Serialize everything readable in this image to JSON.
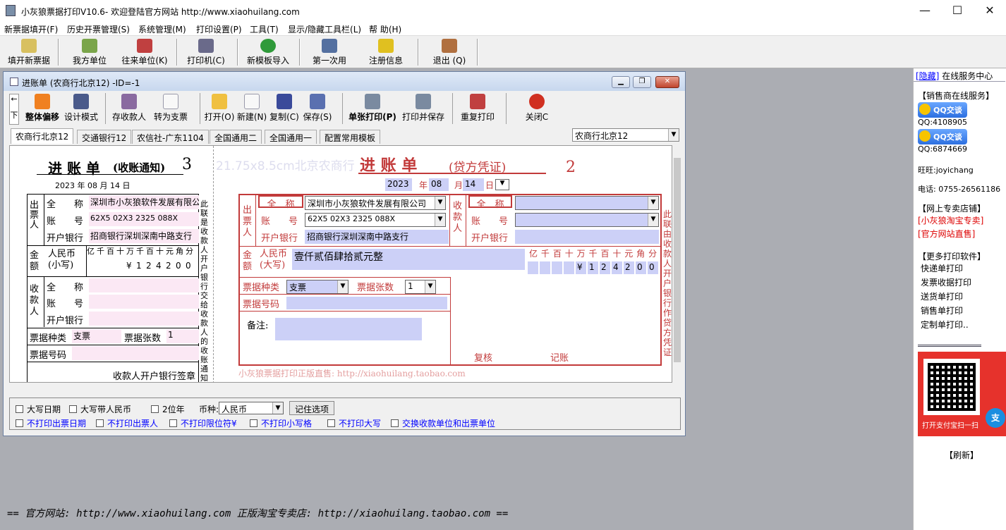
{
  "app": {
    "title": "小灰狼票据打印V10.6- 欢迎登陆官方网站 http://www.xiaohuilang.com",
    "minimize": "—",
    "maximize": "☐",
    "close": "✕"
  },
  "menu": [
    "新票据填开(F)",
    "历史开票管理(S)",
    "系统管理(M)",
    "打印设置(P)",
    "工具(T)",
    "显示/隐藏工具栏(L)",
    "帮 助(H)"
  ],
  "toolbar": [
    "填开新票据",
    "我方单位",
    "往来单位(K)",
    "打印机(C)",
    "新模板导入",
    "第一次用",
    "注册信息",
    "退出 (Q)"
  ],
  "child": {
    "title": "进账单 (农商行北京12) -ID=-1",
    "nav_up": "←",
    "nav_down": "下",
    "tools": [
      "整体偏移",
      "设计模式",
      "存收款人",
      "转为支票",
      "打开(O)",
      "新建(N)",
      "复制(C)",
      "保存(S)",
      "单张打印(P)",
      "打印并保存",
      "重复打印",
      "关闭C"
    ],
    "tabs": [
      "农商行北京12",
      "交通银行12",
      "农信社-广东1104",
      "全国通用二",
      "全国通用一",
      "配置常用模板"
    ],
    "template_select": "农商行北京12"
  },
  "left_copy": {
    "title": "进 账 单",
    "subtitle": "(收账通知)",
    "copy_no": "3",
    "date_year": "2023",
    "date_month": "08",
    "date_day": "14",
    "ymd": [
      "年",
      "月",
      "日"
    ],
    "payer_label": "出票人",
    "payee_label": "收款人",
    "amount_label": "金额",
    "rows": {
      "name": "全　　称",
      "account": "账　　号",
      "bank": "开户银行"
    },
    "payer_name": "深圳市小灰狼软件发展有限公",
    "payer_account": "62X5 02X3 2325 088X",
    "payer_bank": "招商银行深圳深南中路支行",
    "rmb_label": "人民币(小写)",
    "digits_head": [
      "亿",
      "千",
      "百",
      "十",
      "万",
      "千",
      "百",
      "十",
      "元",
      "角",
      "分"
    ],
    "digits": [
      "",
      "",
      "",
      "",
      "¥",
      "1",
      "2",
      "4",
      "2",
      "0",
      "0"
    ],
    "bill_type_label": "票据种类",
    "bill_type": "支票",
    "bill_count_label": "票据张数",
    "bill_count": "1",
    "bill_no_label": "票据号码",
    "side_note": "此联是收款人开户银行交给收款人的收账通知",
    "sign": "收款人开户银行签章"
  },
  "right_copy": {
    "watermark": "21.75x8.5cm北京农商行",
    "title": "进 账 单",
    "subtitle": "(贷方凭证)",
    "copy_no": "2",
    "date_year": "2023",
    "date_month": "08",
    "date_day": "14",
    "payer_label": "出票人",
    "payee_label": "收款人",
    "name_label": "全　称",
    "account_label": "账　　号",
    "bank_label": "开户银行",
    "payer_name": "深圳市小灰狼软件发展有限公司",
    "payer_account": "62X5 02X3 2325 088X",
    "payer_bank": "招商银行深圳深南中路支行",
    "amount_label": "金额",
    "rmb_label": "人民币(大写)",
    "amount_words": "壹仟贰佰肆拾贰元整",
    "digits_head": [
      "亿",
      "千",
      "百",
      "十",
      "万",
      "千",
      "百",
      "十",
      "元",
      "角",
      "分"
    ],
    "digits": [
      "",
      "",
      "",
      "",
      "¥",
      "1",
      "2",
      "4",
      "2",
      "0",
      "0"
    ],
    "bill_type_label": "票据种类",
    "bill_type": "支票",
    "bill_count_label": "票据张数",
    "bill_count": "1",
    "bill_no_label": "票据号码",
    "remark_label": "备注:",
    "review": "复核",
    "bookkeep": "记账",
    "side_note": "此联由收款人开户银行作贷方凭证",
    "footer": "小灰狼票据打印正版直售: http://xiaohuilang.taobao.com"
  },
  "options": {
    "row1": [
      "大写日期",
      "大写带人民币",
      "2位年"
    ],
    "currency_label": "币种:",
    "currency": "人民币",
    "remember": "记住选项",
    "row2": [
      "不打印出票日期",
      "不打印出票人",
      "不打印限位符¥",
      "不打印小写格",
      "不打印大写",
      "交换收款单位和出票单位"
    ]
  },
  "status": "== 官方网站: http://www.xiaohuilang.com 正版淘宝专卖店: http://xiaohuilang.taobao.com ==",
  "right": {
    "hide": "[隐藏]",
    "service": "在线服务中心",
    "sales": "【销售商在线服务】",
    "qq_btn": "QQ交谈",
    "qq1": "QQ:4108905",
    "qq2": "QQ:6874669",
    "wangwang": "旺旺:joyichang",
    "phone": "电话: 0755-26561186",
    "shop": "【网上专卖店铺】",
    "shop1": "[小灰狼淘宝专卖]",
    "shop2": "[官方网站直售]",
    "more": "【更多打印软件】",
    "soft": [
      "快递单打印",
      "发票收据打印",
      "送货单打印",
      "销售单打印",
      "定制单打印.."
    ],
    "qr_text": "打开支付宝扫一扫",
    "refresh": "【刷新】"
  }
}
